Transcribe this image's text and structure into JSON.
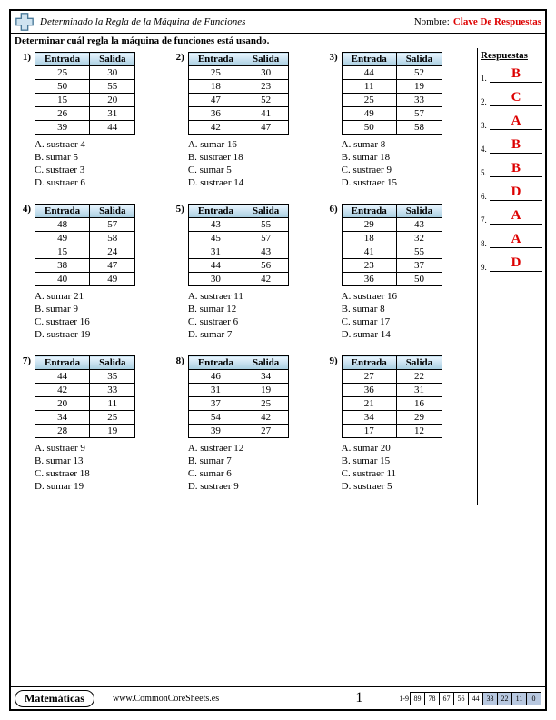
{
  "header": {
    "title": "Determinado la Regla de la Máquina de Funciones",
    "nameLabel": "Nombre:",
    "answerKey": "Clave De Respuestas"
  },
  "instruction": "Determinar cuál regla la máquina de funciones está usando.",
  "cols": {
    "in": "Entrada",
    "out": "Salida"
  },
  "problems": [
    {
      "n": "1)",
      "rows": [
        [
          "25",
          "30"
        ],
        [
          "50",
          "55"
        ],
        [
          "15",
          "20"
        ],
        [
          "26",
          "31"
        ],
        [
          "39",
          "44"
        ]
      ],
      "opts": [
        "A. sustraer 4",
        "B. sumar 5",
        "C. sustraer 3",
        "D. sustraer 6"
      ]
    },
    {
      "n": "2)",
      "rows": [
        [
          "25",
          "30"
        ],
        [
          "18",
          "23"
        ],
        [
          "47",
          "52"
        ],
        [
          "36",
          "41"
        ],
        [
          "42",
          "47"
        ]
      ],
      "opts": [
        "A. sumar 16",
        "B. sustraer 18",
        "C. sumar 5",
        "D. sustraer 14"
      ]
    },
    {
      "n": "3)",
      "rows": [
        [
          "44",
          "52"
        ],
        [
          "11",
          "19"
        ],
        [
          "25",
          "33"
        ],
        [
          "49",
          "57"
        ],
        [
          "50",
          "58"
        ]
      ],
      "opts": [
        "A. sumar 8",
        "B. sumar 18",
        "C. sustraer 9",
        "D. sustraer 15"
      ]
    },
    {
      "n": "4)",
      "rows": [
        [
          "48",
          "57"
        ],
        [
          "49",
          "58"
        ],
        [
          "15",
          "24"
        ],
        [
          "38",
          "47"
        ],
        [
          "40",
          "49"
        ]
      ],
      "opts": [
        "A. sumar 21",
        "B. sumar 9",
        "C. sustraer 16",
        "D. sustraer 19"
      ]
    },
    {
      "n": "5)",
      "rows": [
        [
          "43",
          "55"
        ],
        [
          "45",
          "57"
        ],
        [
          "31",
          "43"
        ],
        [
          "44",
          "56"
        ],
        [
          "30",
          "42"
        ]
      ],
      "opts": [
        "A. sustraer 11",
        "B. sumar 12",
        "C. sustraer 6",
        "D. sumar 7"
      ]
    },
    {
      "n": "6)",
      "rows": [
        [
          "29",
          "43"
        ],
        [
          "18",
          "32"
        ],
        [
          "41",
          "55"
        ],
        [
          "23",
          "37"
        ],
        [
          "36",
          "50"
        ]
      ],
      "opts": [
        "A. sustraer 16",
        "B. sumar 8",
        "C. sumar 17",
        "D. sumar 14"
      ]
    },
    {
      "n": "7)",
      "rows": [
        [
          "44",
          "35"
        ],
        [
          "42",
          "33"
        ],
        [
          "20",
          "11"
        ],
        [
          "34",
          "25"
        ],
        [
          "28",
          "19"
        ]
      ],
      "opts": [
        "A. sustraer 9",
        "B. sumar 13",
        "C. sustraer 18",
        "D. sumar 19"
      ]
    },
    {
      "n": "8)",
      "rows": [
        [
          "46",
          "34"
        ],
        [
          "31",
          "19"
        ],
        [
          "37",
          "25"
        ],
        [
          "54",
          "42"
        ],
        [
          "39",
          "27"
        ]
      ],
      "opts": [
        "A. sustraer 12",
        "B. sumar 7",
        "C. sumar 6",
        "D. sustraer 9"
      ]
    },
    {
      "n": "9)",
      "rows": [
        [
          "27",
          "22"
        ],
        [
          "36",
          "31"
        ],
        [
          "21",
          "16"
        ],
        [
          "34",
          "29"
        ],
        [
          "17",
          "12"
        ]
      ],
      "opts": [
        "A. sumar 20",
        "B. sumar 15",
        "C. sustraer 11",
        "D. sustraer 5"
      ]
    }
  ],
  "answers": {
    "heading": "Respuestas",
    "items": [
      {
        "n": "1.",
        "v": "B"
      },
      {
        "n": "2.",
        "v": "C"
      },
      {
        "n": "3.",
        "v": "A"
      },
      {
        "n": "4.",
        "v": "B"
      },
      {
        "n": "5.",
        "v": "B"
      },
      {
        "n": "6.",
        "v": "D"
      },
      {
        "n": "7.",
        "v": "A"
      },
      {
        "n": "8.",
        "v": "A"
      },
      {
        "n": "9.",
        "v": "D"
      }
    ]
  },
  "footer": {
    "subject": "Matemáticas",
    "site": "www.CommonCoreSheets.es",
    "page": "1",
    "range": "1-9",
    "scale": [
      "89",
      "78",
      "67",
      "56",
      "44",
      "33",
      "22",
      "11",
      "0"
    ],
    "shadedFrom": 5
  }
}
